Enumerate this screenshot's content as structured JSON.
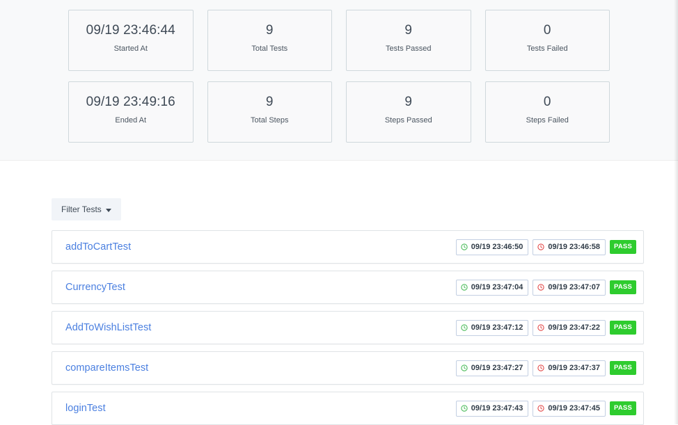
{
  "summary": {
    "cards_row1": [
      {
        "value": "09/19 23:46:44",
        "label": "Started At"
      },
      {
        "value": "9",
        "label": "Total Tests"
      },
      {
        "value": "9",
        "label": "Tests Passed"
      },
      {
        "value": "0",
        "label": "Tests Failed"
      }
    ],
    "cards_row2": [
      {
        "value": "09/19 23:49:16",
        "label": "Ended At"
      },
      {
        "value": "9",
        "label": "Total Steps"
      },
      {
        "value": "9",
        "label": "Steps Passed"
      },
      {
        "value": "0",
        "label": "Steps Failed"
      }
    ]
  },
  "toolbar": {
    "filter_label": "Filter Tests",
    "filter_caret_icon": "chevron-down-icon"
  },
  "tests": [
    {
      "name": "addToCartTest",
      "start_time": "09/19 23:46:50",
      "end_time": "09/19 23:46:58",
      "status": "PASS",
      "start_icon": "clock-start-icon",
      "end_icon": "clock-end-icon"
    },
    {
      "name": "CurrencyTest",
      "start_time": "09/19 23:47:04",
      "end_time": "09/19 23:47:07",
      "status": "PASS",
      "start_icon": "clock-start-icon",
      "end_icon": "clock-end-icon"
    },
    {
      "name": "AddToWishListTest",
      "start_time": "09/19 23:47:12",
      "end_time": "09/19 23:47:22",
      "status": "PASS",
      "start_icon": "clock-start-icon",
      "end_icon": "clock-end-icon"
    },
    {
      "name": "compareItemsTest",
      "start_time": "09/19 23:47:27",
      "end_time": "09/19 23:47:37",
      "status": "PASS",
      "start_icon": "clock-start-icon",
      "end_icon": "clock-end-icon"
    },
    {
      "name": "loginTest",
      "start_time": "09/19 23:47:43",
      "end_time": "09/19 23:47:45",
      "status": "PASS",
      "start_icon": "clock-start-icon",
      "end_icon": "clock-end-icon"
    }
  ],
  "colors": {
    "link": "#4a7fe0",
    "pass": "#2ecc2e",
    "start_icon": "#39b54a",
    "end_icon": "#e03a3a",
    "summary_bg": "#f8f9fa",
    "card_border": "#cfd8dc"
  }
}
